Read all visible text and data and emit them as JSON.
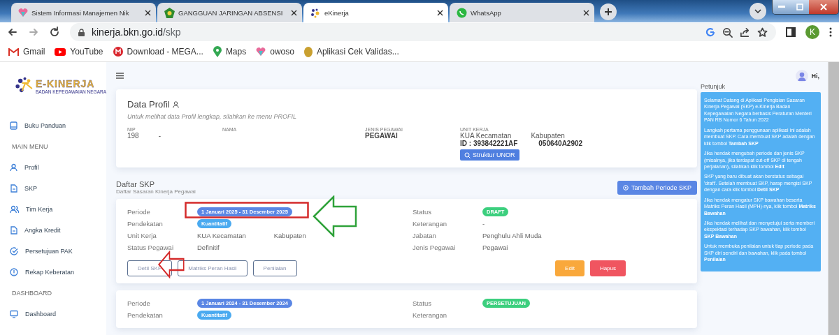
{
  "browser": {
    "tabs": [
      {
        "title": "Sistem Informasi Manajemen Nik",
        "selected": false
      },
      {
        "title": "GANGGUAN JARINGAN ABSENSI",
        "selected": false
      },
      {
        "title": "eKinerja",
        "selected": true
      },
      {
        "title": "WhatsApp",
        "selected": false
      }
    ],
    "url_host": "kinerja.bkn.go.id",
    "url_path": "/skp",
    "profile_initial": "K",
    "bookmarks": [
      {
        "label": "Gmail"
      },
      {
        "label": "YouTube"
      },
      {
        "label": "Download - MEGA..."
      },
      {
        "label": "Maps"
      },
      {
        "label": "owoso"
      },
      {
        "label": "Aplikasi Cek Validas..."
      }
    ]
  },
  "sidebar": {
    "logo_title": "E-KINERJA",
    "logo_subtitle": "BADAN KEPEGAWAIAN NEGARA",
    "items": [
      {
        "kind": "item",
        "label": "Buku Panduan"
      },
      {
        "kind": "section",
        "label": "MAIN MENU"
      },
      {
        "kind": "item",
        "label": "Profil"
      },
      {
        "kind": "item",
        "label": "SKP"
      },
      {
        "kind": "item",
        "label": "Tim Kerja"
      },
      {
        "kind": "item",
        "label": "Angka Kredit"
      },
      {
        "kind": "item",
        "label": "Persetujuan PAK"
      },
      {
        "kind": "item",
        "label": "Rekap Keberatan"
      },
      {
        "kind": "section",
        "label": "DASHBOARD"
      },
      {
        "kind": "item",
        "label": "Dashboard"
      }
    ]
  },
  "header": {
    "greeting": "Hi,"
  },
  "profile_card": {
    "title": "Data Profil",
    "subtitle": "Untuk melihat data Profil lengkap, silahkan ke menu PROFIL",
    "fields": [
      {
        "label": "NIP",
        "values": [
          "198",
          "-"
        ]
      },
      {
        "label": "NAMA"
      },
      {
        "label": "JENIS PEGAWAI",
        "values": [
          "PEGAWAI"
        ]
      },
      {
        "label": "UNIT KERJA",
        "values": [
          "KUA Kecamatan",
          "Kabupaten"
        ]
      }
    ],
    "unit_id": [
      "ID : 393842221AF",
      "050640A2902"
    ],
    "unor_button": "Struktur UNOR"
  },
  "skp_list": {
    "title": "Daftar SKP",
    "subtitle": "Daftar Sasaran Kinerja Pegawai",
    "add_button": "Tambah Periode SKP",
    "cards": [
      {
        "left": [
          {
            "label": "Periode",
            "kind": "badge",
            "color": "#5a86e4",
            "values": [
              "1 Januari 2025 - 31 Desember 2025"
            ]
          },
          {
            "label": "Pendekatan",
            "kind": "badge",
            "color": "#4aaaf0",
            "values": [
              "Kuantitatif"
            ]
          },
          {
            "label": "Unit Kerja",
            "kind": "text",
            "values": [
              "KUA Kecamatan",
              "Kabupaten"
            ]
          },
          {
            "label": "Status Pegawai",
            "kind": "text",
            "values": [
              "Definitif"
            ]
          }
        ],
        "right": [
          {
            "label": "Status",
            "kind": "badge",
            "color": "#3ccf7e",
            "values": [
              "DRAFT"
            ]
          },
          {
            "label": "Keterangan",
            "kind": "text",
            "values": [
              "-"
            ]
          },
          {
            "label": "Jabatan",
            "kind": "text",
            "values": [
              "Penghulu Ahli Muda"
            ]
          },
          {
            "label": "Jenis Pegawai",
            "kind": "text",
            "values": [
              "Pegawai"
            ]
          }
        ],
        "actions": [
          {
            "label": "Detil SKP",
            "kind": "outline"
          },
          {
            "label": "Matriks Peran Hasil",
            "kind": "outline"
          },
          {
            "label": "Penilaian",
            "kind": "outline"
          },
          {
            "label": "Edit",
            "kind": "warning"
          },
          {
            "label": "Hapus",
            "kind": "danger"
          }
        ],
        "annotated": true
      },
      {
        "left": [
          {
            "label": "Periode",
            "kind": "badge",
            "color": "#5a86e4",
            "values": [
              "1 Januari 2024 - 31 Desember 2024"
            ]
          },
          {
            "label": "Pendekatan",
            "kind": "badge",
            "color": "#4aaaf0",
            "values": [
              "Kuantitatif"
            ]
          }
        ],
        "right": [
          {
            "label": "Status",
            "kind": "badge",
            "color": "#3ccf7e",
            "values": [
              "PERSETUJUAN"
            ]
          },
          {
            "label": "Keterangan",
            "kind": "text"
          }
        ],
        "annotated": false
      }
    ]
  },
  "petunjuk": {
    "title": "Petunjuk",
    "paragraphs": [
      "Selamat Datang di Aplikasi Pengisian Sasaran Kinerja Pegawai (SKP) e-Kinerja Badan Kepegawaian Negara berbasis Peraturan Menteri PAN RB Nomor 6 Tahun 2022",
      "Langkah pertama penggunaan aplikasi ini adalah membuat SKP. Cara membuat SKP adalah dengan klik tombol **Tambah SKP**",
      "Jika hendak mengubah periode dan jenis SKP (misalnya, jika terdapat cut-off SKP di tengah perjalanan), silahkan klik tombol **Edit**",
      "SKP yang baru dibuat akan berstatus sebagai 'draft'. Setelah membuat SKP, harap mengisi SKP dengan cara klik tombol **Detil SKP**",
      "Jika hendak mengatur SKP bawahan beserta Matriks Peran Hasil (MPH)-nya, klik tombol **Matriks Bawahan**",
      "Jika hendak melihat dan menyetujui serta memberi ekspektasi terhadap SKP bawahan, klik tombol **SKP Bawahan**",
      "Untuk membuka penilaian untuk tiap periode pada SKP diri sendiri dan bawahan, klik pada tombol **Penilaian**"
    ]
  }
}
